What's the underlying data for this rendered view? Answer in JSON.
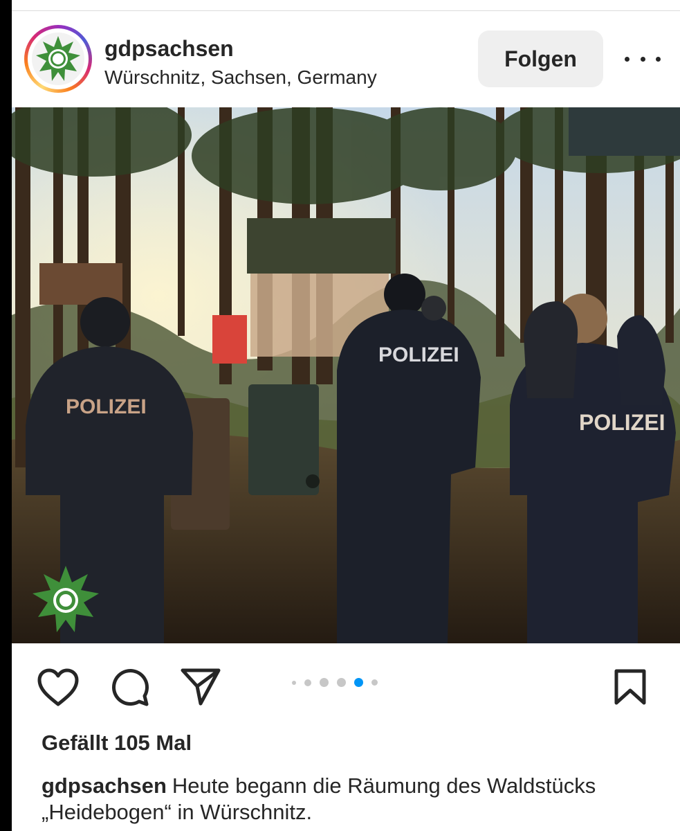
{
  "post": {
    "username": "gdpsachsen",
    "location": "Würschnitz, Sachsen, Germany",
    "follow_label": "Folgen",
    "more_icon": "more-horizontal-icon",
    "avatar_icon": "gdp-logo-icon"
  },
  "carousel": {
    "total": 6,
    "active_index": 3
  },
  "image": {
    "vest_labels": [
      "POLIZEI",
      "POLIZEI",
      "POLIZEI"
    ],
    "watermark_icon": "gdp-logo-icon"
  },
  "actions": {
    "icons": [
      "heart-icon",
      "comment-icon",
      "share-icon",
      "bookmark-icon"
    ]
  },
  "likes": "Gefällt 105 Mal",
  "caption": {
    "user": "gdpsachsen",
    "text": "Heute begann die Räumung des Waldstücks „Heidebogen“ in Würschnitz."
  },
  "colors": {
    "accent_blue": "#0095f6",
    "gdp_green": "#3f8f3a",
    "text": "#262626"
  }
}
